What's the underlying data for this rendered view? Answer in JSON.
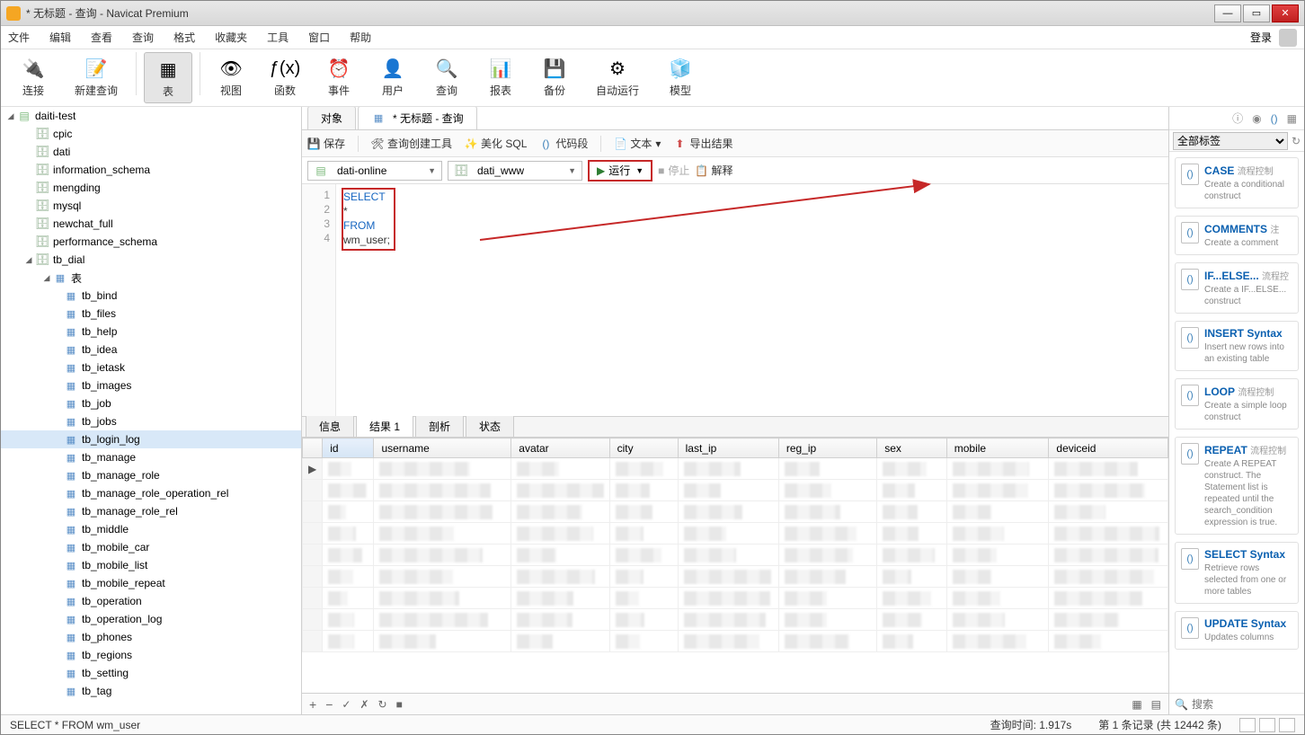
{
  "window": {
    "title": "* 无标题 - 查询 - Navicat Premium"
  },
  "menubar": {
    "items": [
      "文件",
      "编辑",
      "查看",
      "查询",
      "格式",
      "收藏夹",
      "工具",
      "窗口",
      "帮助"
    ],
    "login": "登录"
  },
  "toolbar": {
    "items": [
      "连接",
      "新建查询",
      "表",
      "视图",
      "函数",
      "事件",
      "用户",
      "查询",
      "报表",
      "备份",
      "自动运行",
      "模型"
    ],
    "active_index": 2
  },
  "tree": {
    "connection": "daiti-test",
    "databases": [
      "cpic",
      "dati",
      "information_schema",
      "mengding",
      "mysql",
      "newchat_full",
      "performance_schema"
    ],
    "db_open": "tb_dial",
    "table_folder": "表",
    "tables": [
      "tb_bind",
      "tb_files",
      "tb_help",
      "tb_idea",
      "tb_ietask",
      "tb_images",
      "tb_job",
      "tb_jobs",
      "tb_login_log",
      "tb_manage",
      "tb_manage_role",
      "tb_manage_role_operation_rel",
      "tb_manage_role_rel",
      "tb_middle",
      "tb_mobile_car",
      "tb_mobile_list",
      "tb_mobile_repeat",
      "tb_operation",
      "tb_operation_log",
      "tb_phones",
      "tb_regions",
      "tb_setting",
      "tb_tag"
    ],
    "selected_table": "tb_login_log"
  },
  "tabs": {
    "items": [
      {
        "label": "对象",
        "active": false
      },
      {
        "label": "* 无标题 - 查询",
        "active": true
      }
    ]
  },
  "query_toolbar": {
    "save": "保存",
    "builder": "查询创建工具",
    "beautify": "美化 SQL",
    "snippets": "代码段",
    "text": "文本",
    "export": "导出结果"
  },
  "selectors": {
    "connection": "dati-online",
    "database": "dati_www",
    "run": "运行",
    "stop": "停止",
    "explain": "解释"
  },
  "sql": {
    "lines": [
      "SELECT",
      "    *",
      "FROM",
      "    wm_user;"
    ],
    "gutter": [
      "1",
      "2",
      "3",
      "4"
    ]
  },
  "result_tabs": [
    "信息",
    "结果 1",
    "剖析",
    "状态"
  ],
  "result_tabs_active": 1,
  "grid": {
    "columns": [
      "id",
      "username",
      "avatar",
      "city",
      "last_ip",
      "reg_ip",
      "sex",
      "mobile",
      "deviceid"
    ],
    "sorted_col": 0,
    "row_count": 9
  },
  "grid_footer": {
    "ops": [
      "+",
      "−",
      "✓",
      "✗",
      "↻",
      "■"
    ]
  },
  "statusbar": {
    "sql": "SELECT   *  FROM  wm_user",
    "query_time": "查询时间: 1.917s",
    "records": "第 1 条记录 (共 12442 条)"
  },
  "right_panel": {
    "filter": "全部标签",
    "search_placeholder": "搜索",
    "snippets": [
      {
        "title": "CASE",
        "tag": "流程控制",
        "desc": "Create a conditional construct"
      },
      {
        "title": "COMMENTS",
        "tag": "注",
        "desc": "Create a comment"
      },
      {
        "title": "IF...ELSE...",
        "tag": "流程控",
        "desc": "Create a IF...ELSE... construct"
      },
      {
        "title": "INSERT Syntax",
        "tag": "",
        "desc": "Insert new rows into an existing table"
      },
      {
        "title": "LOOP",
        "tag": "流程控制",
        "desc": "Create a simple loop construct"
      },
      {
        "title": "REPEAT",
        "tag": "流程控制",
        "desc": "Create A REPEAT construct. The Statement list is repeated until the search_condition expression is true."
      },
      {
        "title": "SELECT Syntax",
        "tag": "",
        "desc": "Retrieve rows selected from one or more tables"
      },
      {
        "title": "UPDATE Syntax",
        "tag": "",
        "desc": "Updates columns"
      }
    ]
  }
}
